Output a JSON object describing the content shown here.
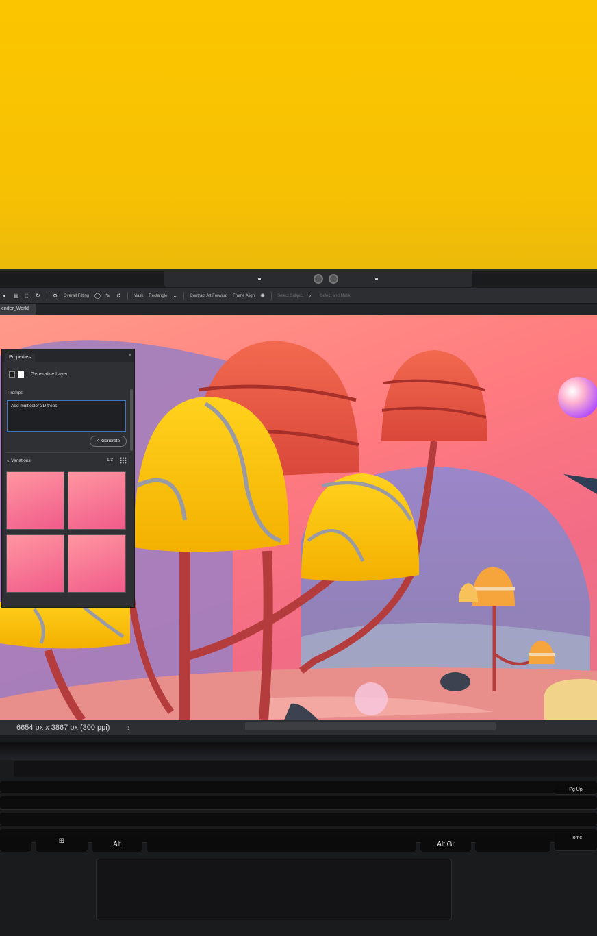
{
  "app": {
    "document_tab": "ender_World",
    "toolbar_items": [
      {
        "label": "Overall Fitting",
        "dim": false
      },
      {
        "label": "Mask",
        "dim": false
      },
      {
        "label": "Rectangle",
        "dim": false
      },
      {
        "label": "Contract Alt Forward",
        "dim": false
      },
      {
        "label": "Frame Align",
        "dim": false
      },
      {
        "label": "Select Subject",
        "dim": true
      },
      {
        "label": "Select and Mask",
        "dim": true
      }
    ]
  },
  "properties_panel": {
    "tab": "Properties",
    "layer_type": "Generative Layer",
    "prompt_label": "Prompt:",
    "prompt_value": "Add multicolor 3D trees",
    "generate_button": "Generate",
    "variations_label": "Variations",
    "variations_count": "1/3"
  },
  "status": {
    "dimensions": "6654 px x 3867 px (300 ppi)"
  },
  "keyboard": {
    "keys": [
      "Alt",
      "Alt Gr",
      "Pg Up",
      "Home"
    ]
  }
}
